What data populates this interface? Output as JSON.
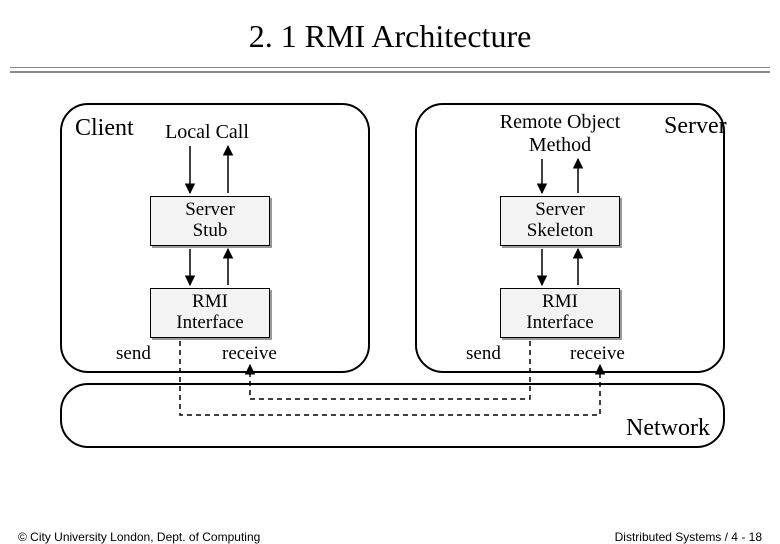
{
  "title": "2. 1 RMI Architecture",
  "client": {
    "host_label": "Client",
    "call_label": "Local Call",
    "stub": "Server\nStub",
    "rmi": "RMI\nInterface",
    "send": "send",
    "receive": "receive"
  },
  "server": {
    "host_label": "Server",
    "call_label": "Remote Object\nMethod",
    "skeleton": "Server\nSkeleton",
    "rmi": "RMI\nInterface",
    "send": "send",
    "receive": "receive"
  },
  "network_label": "Network",
  "footer": {
    "left": "© City University London, Dept. of Computing",
    "right": "Distributed Systems / 4 - 18"
  }
}
